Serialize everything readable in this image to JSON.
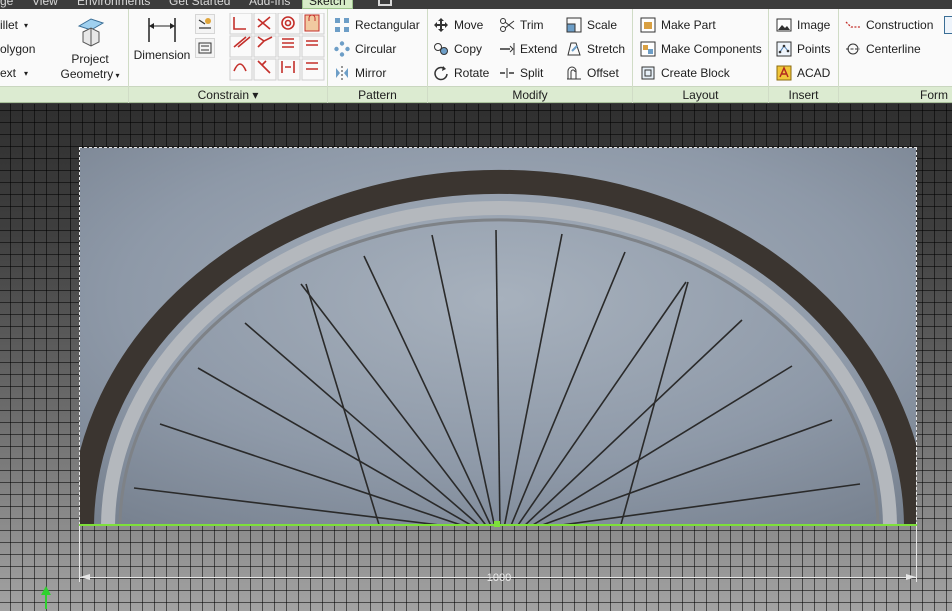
{
  "tabs": [
    {
      "label": "ge"
    },
    {
      "label": "View"
    },
    {
      "label": "Environments"
    },
    {
      "label": "Get Started"
    },
    {
      "label": "Add-Ins"
    },
    {
      "label": "Sketch",
      "active": true
    }
  ],
  "draw": {
    "items": [
      {
        "label": "illet"
      },
      {
        "label": "olygon"
      },
      {
        "label": "ext"
      }
    ],
    "project_geometry": {
      "line1": "Project",
      "line2": "Geometry"
    }
  },
  "constrain": {
    "dimension": "Dimension",
    "panel_label": "Constrain ▾"
  },
  "pattern": {
    "items": [
      {
        "label": "Rectangular"
      },
      {
        "label": "Circular"
      },
      {
        "label": "Mirror"
      }
    ],
    "panel_label": "Pattern"
  },
  "modify": {
    "col1": [
      {
        "label": "Move"
      },
      {
        "label": "Copy"
      },
      {
        "label": "Rotate"
      }
    ],
    "col2": [
      {
        "label": "Trim"
      },
      {
        "label": "Extend"
      },
      {
        "label": "Split"
      }
    ],
    "col3": [
      {
        "label": "Scale"
      },
      {
        "label": "Stretch"
      },
      {
        "label": "Offset"
      }
    ],
    "panel_label": "Modify"
  },
  "layout": {
    "items": [
      {
        "label": "Make Part"
      },
      {
        "label": "Make Components"
      },
      {
        "label": "Create Block"
      }
    ],
    "panel_label": "Layout"
  },
  "insert": {
    "items": [
      {
        "label": "Image"
      },
      {
        "label": "Points"
      },
      {
        "label": "ACAD"
      }
    ],
    "panel_label": "Insert"
  },
  "format": {
    "items": [
      {
        "label": "Construction"
      },
      {
        "label": "Centerline"
      }
    ],
    "panel_label": "Form"
  },
  "canvas": {
    "dimension_value": "1000"
  },
  "colors": {
    "active_tab": "#d7ecc8",
    "panel_bar": "#dcebd1",
    "sketch_line": "#7ee03a",
    "grid_bg": "#4d4d4d"
  }
}
